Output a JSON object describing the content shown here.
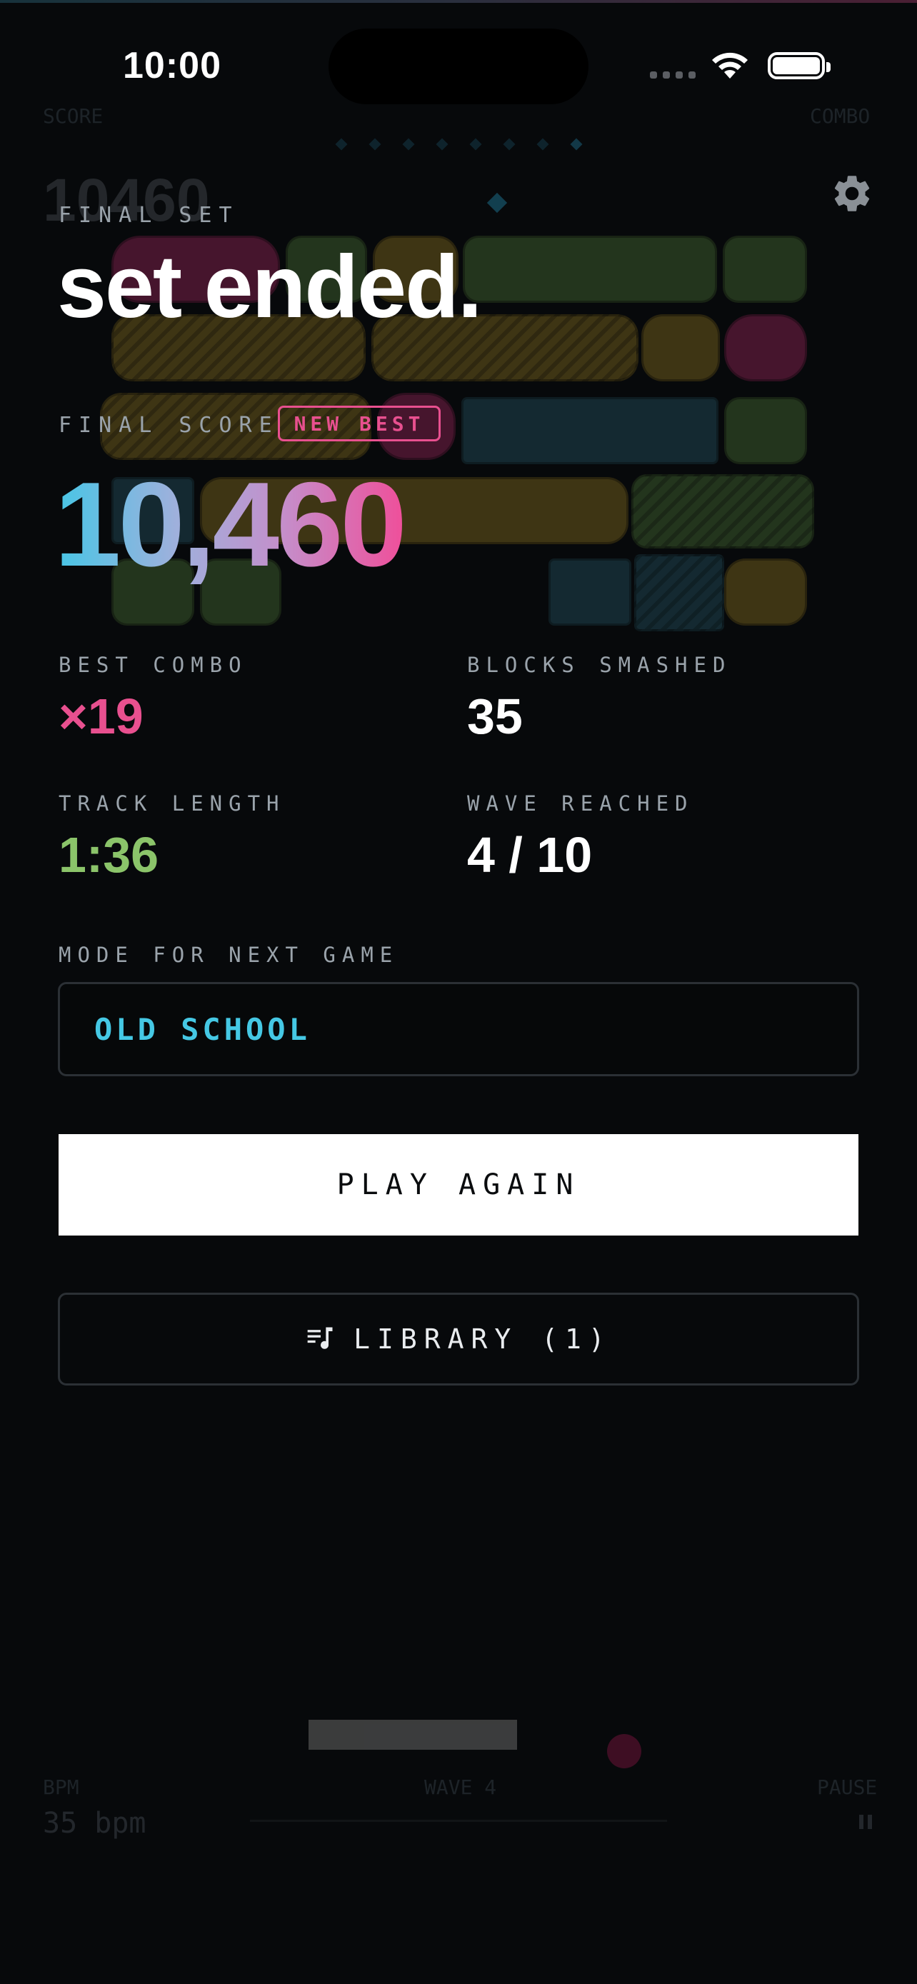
{
  "status_bar": {
    "time": "10:00"
  },
  "background_game": {
    "score_label": "SCORE",
    "combo_label": "COMBO",
    "score_value": "10460",
    "bpm_label": "BPM",
    "bpm_value": "35 bpm",
    "wave_label": "WAVE 4",
    "pause_label": "PAUSE"
  },
  "results": {
    "eyebrow": "FINAL SET",
    "headline": "set ended.",
    "final_score_label": "FINAL SCORE",
    "new_best_badge": "NEW BEST",
    "final_score": "10,460",
    "stats": [
      {
        "label": "BEST COMBO",
        "value": "×19",
        "color": "#e8508f"
      },
      {
        "label": "BLOCKS SMASHED",
        "value": "35",
        "color": "#ffffff"
      },
      {
        "label": "TRACK LENGTH",
        "value": "1:36",
        "color": "#8bc46a"
      },
      {
        "label": "WAVE REACHED",
        "value": "4 / 10",
        "color": "#ffffff"
      }
    ]
  },
  "mode": {
    "label": "MODE FOR NEXT GAME",
    "selected": "OLD SCHOOL"
  },
  "actions": {
    "play_again": "PLAY AGAIN",
    "library": "LIBRARY (1)"
  },
  "icons": [
    "gear-icon",
    "library-music-icon",
    "wifi-icon",
    "battery-icon",
    "pause-icon"
  ],
  "colors": {
    "accent_pink": "#e8508f",
    "accent_cyan": "#45c8e4",
    "accent_green": "#8bc46a",
    "background": "#07090b"
  }
}
